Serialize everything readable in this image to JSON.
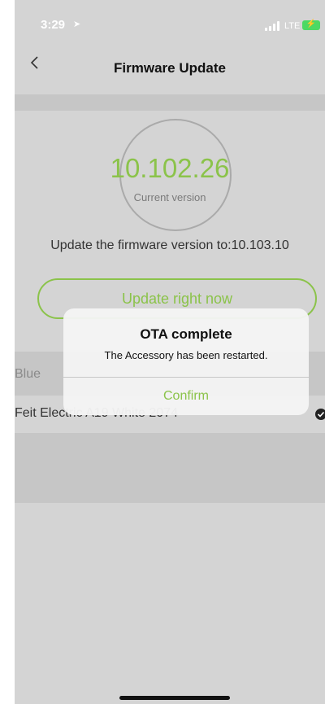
{
  "status_bar": {
    "time": "3:29",
    "network": "LTE"
  },
  "nav": {
    "title": "Firmware Update",
    "back_icon": "chevron-left-icon"
  },
  "firmware": {
    "current_version": "10.102.26",
    "current_label": "Current version",
    "update_message": "Update the firmware version to:10.103.10",
    "update_button": "Update right now"
  },
  "list": {
    "header": "Blue",
    "devices": [
      {
        "name": "Feit Electric A19 White 2074",
        "checked": true
      }
    ]
  },
  "alert": {
    "title": "OTA complete",
    "message": "The Accessory has been restarted.",
    "confirm_label": "Confirm"
  },
  "colors": {
    "accent": "#8bc34a",
    "background": "#d4d4d4",
    "section": "#c6c6c6"
  }
}
